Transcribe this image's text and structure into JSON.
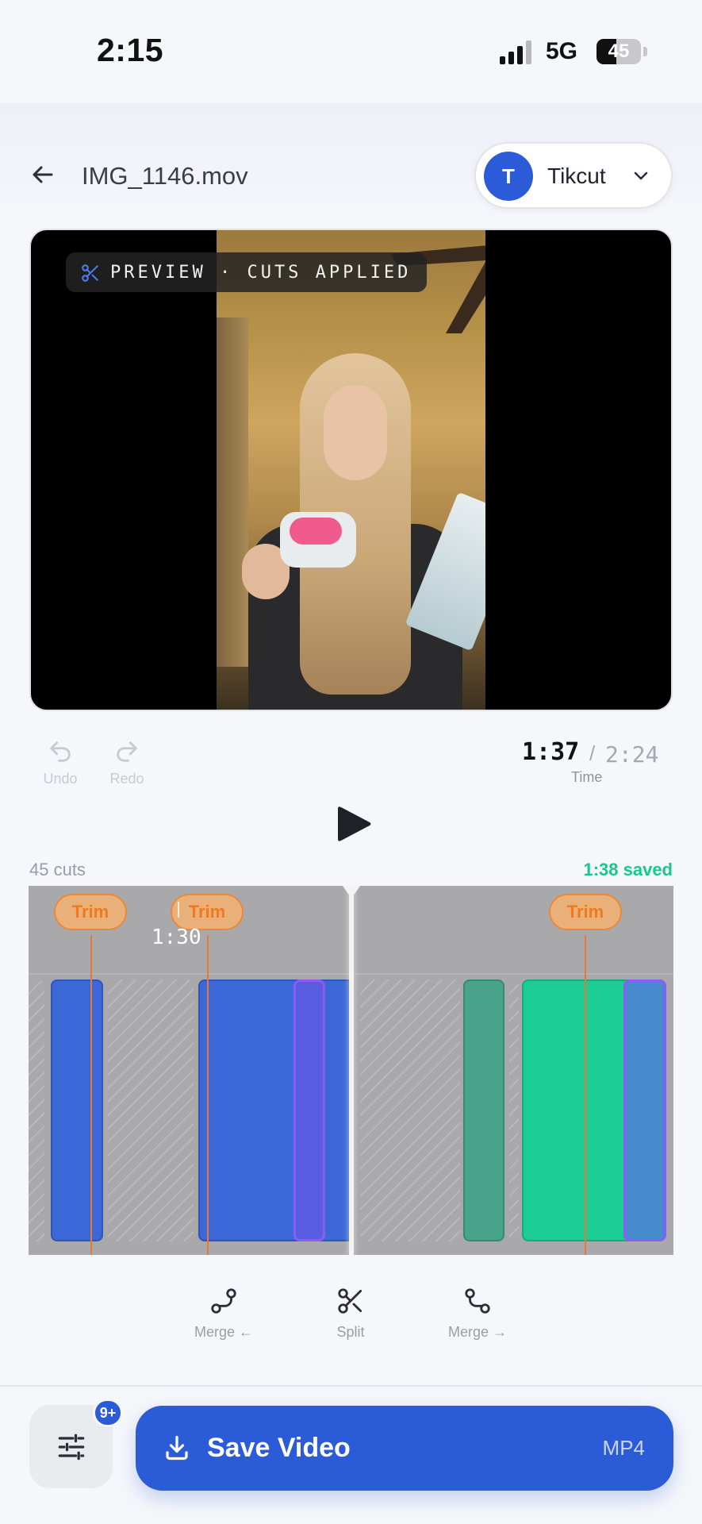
{
  "status": {
    "time": "2:15",
    "network": "5G",
    "battery": "45",
    "battery_level": 0.45
  },
  "header": {
    "file_name": "IMG_1146.mov",
    "account_initial": "T",
    "account_name": "Tikcut"
  },
  "preview": {
    "label": "PREVIEW · CUTS APPLIED"
  },
  "controls": {
    "undo": "Undo",
    "redo": "Redo",
    "current_time": "1:37",
    "separator": "/",
    "total_time": "2:24",
    "time_label": "Time"
  },
  "timeline": {
    "cuts": "45 cuts",
    "saved": "1:38 saved",
    "trim_label": "Trim",
    "marker_time": "1:30"
  },
  "tools": {
    "merge_left": "Merge ←",
    "split": "Split",
    "merge_right": "Merge →"
  },
  "bottom": {
    "badge": "9+",
    "save_label": "Save Video",
    "format": "MP4"
  },
  "colors": {
    "accent": "#2b5bd7",
    "saved": "#16c98a",
    "trim": "#f07a1d",
    "clip_blue": "#3b68d6",
    "clip_green": "#1ccd93",
    "selected": "#8b5cf6"
  }
}
